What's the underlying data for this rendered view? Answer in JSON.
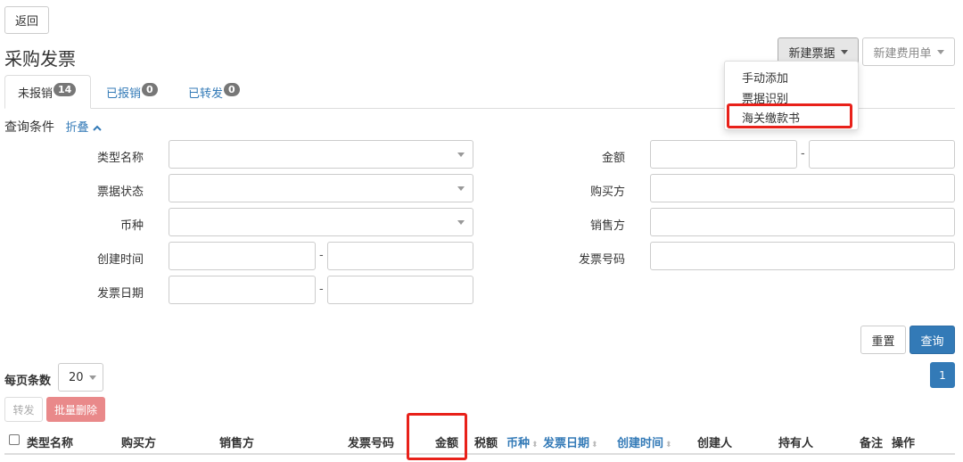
{
  "header": {
    "back_label": "返回",
    "page_title": "采购发票",
    "new_ticket_label": "新建票据",
    "new_expense_label": "新建费用单"
  },
  "dropdown": {
    "items": [
      "手动添加",
      "票据识别",
      "海关缴款书"
    ]
  },
  "tabs": [
    {
      "label": "未报销",
      "count": "14",
      "active": true
    },
    {
      "label": "已报销",
      "count": "0",
      "active": false
    },
    {
      "label": "已转发",
      "count": "0",
      "active": false
    }
  ],
  "query": {
    "title": "查询条件",
    "collapse_label": "折叠",
    "left_labels": [
      "类型名称",
      "票据状态",
      "币种",
      "创建时间",
      "发票日期"
    ],
    "right_labels": [
      "金额",
      "购买方",
      "销售方",
      "发票号码"
    ],
    "range_dash": "-",
    "reset_label": "重置",
    "search_label": "查询"
  },
  "list": {
    "page_size_label": "每页条数",
    "page_size_value": "20",
    "current_page": "1",
    "forward_label": "转发",
    "batch_delete_label": "批量删除",
    "columns": [
      "类型名称",
      "购买方",
      "销售方",
      "发票号码",
      "金额",
      "税额",
      "币种",
      "发票日期",
      "创建时间",
      "创建人",
      "持有人",
      "备注",
      "操作"
    ]
  },
  "colors": {
    "primary": "#337ab7",
    "danger_light": "#e9898a",
    "highlight": "#e8211a",
    "badge": "#777777"
  }
}
